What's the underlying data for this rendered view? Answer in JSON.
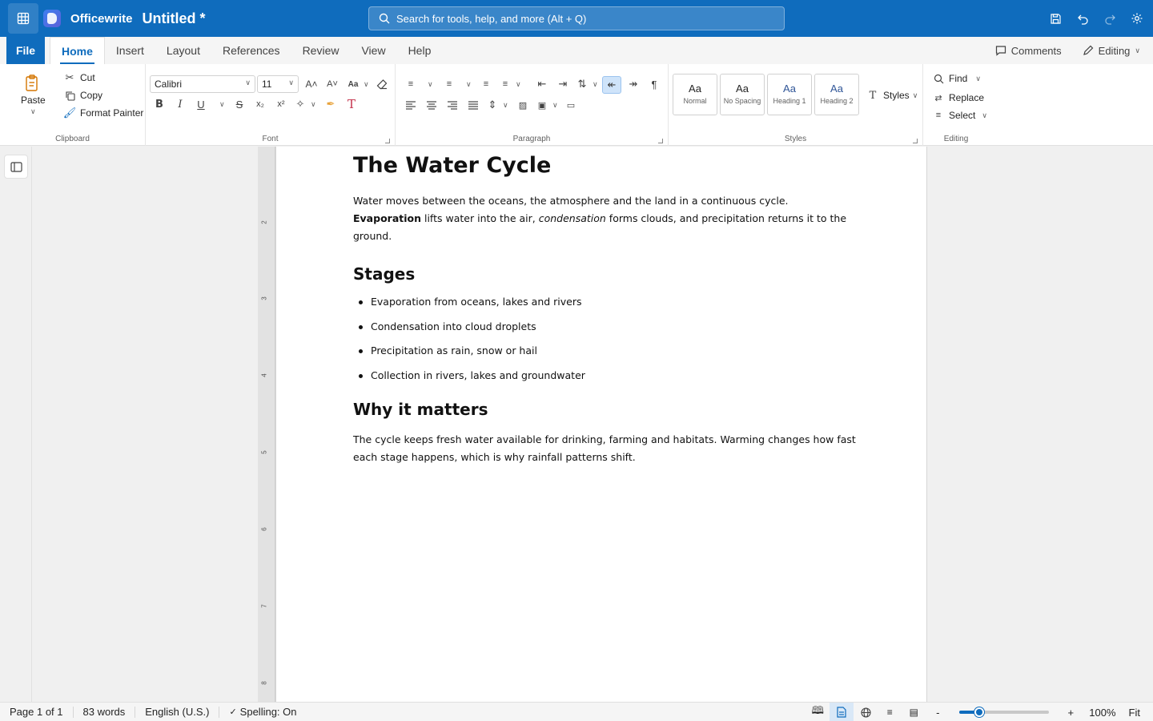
{
  "app": {
    "name": "Officewrite",
    "doc_title": "Untitled *"
  },
  "search": {
    "placeholder": "Search for tools, help, and more (Alt + Q)"
  },
  "tabs": [
    {
      "label": "File"
    },
    {
      "label": "Home"
    },
    {
      "label": "Insert"
    },
    {
      "label": "Layout"
    },
    {
      "label": "References"
    },
    {
      "label": "Review"
    },
    {
      "label": "View"
    },
    {
      "label": "Help"
    }
  ],
  "tabs_right": {
    "comments": "Comments",
    "mode": "Editing"
  },
  "clipboard": {
    "paste": "Paste",
    "cut": "Cut",
    "copy": "Copy",
    "format_painter": "Format Painter",
    "label": "Clipboard"
  },
  "font": {
    "family": "Calibri",
    "size": "11",
    "label": "Font"
  },
  "paragraph": {
    "label": "Paragraph"
  },
  "styles": {
    "items": [
      {
        "preview": "Aa",
        "name": "Normal"
      },
      {
        "preview": "Aa",
        "name": "No Spacing"
      },
      {
        "preview": "Aa",
        "name": "Heading 1"
      },
      {
        "preview": "Aa",
        "name": "Heading 2"
      }
    ],
    "button": "Styles",
    "label": "Styles"
  },
  "editing": {
    "find": "Find",
    "replace": "Replace",
    "select": "Select",
    "label": "Editing"
  },
  "ruler": [
    "2",
    "3",
    "4",
    "5",
    "6",
    "7",
    "8"
  ],
  "document": {
    "title": "The Water Cycle",
    "intro_a": "Water moves between the oceans, the atmosphere and the land in a continuous cycle. ",
    "intro_bold": "Evaporation",
    "intro_b": " lifts water into the air, ",
    "intro_italic": "condensation",
    "intro_c": " forms clouds, and precipitation returns it to the ground.",
    "h_stages": "Stages",
    "stages": [
      "Evaporation from oceans, lakes and rivers",
      "Condensation into cloud droplets",
      "Precipitation as rain, snow or hail",
      "Collection in rivers, lakes and groundwater"
    ],
    "h_why": "Why it matters",
    "why": "The cycle keeps fresh water available for drinking, farming and habitats. Warming changes how fast each stage happens, which is why rainfall patterns shift."
  },
  "status": {
    "page": "Page 1 of 1",
    "words": "83 words",
    "language": "English (U.S.)",
    "spelling": "Spelling: On",
    "zoom_out": "-",
    "zoom_in": "+",
    "zoom": "100%",
    "fit": "Fit",
    "zoom_level": 0.22
  },
  "colors": {
    "accent": "#0f6cbd"
  }
}
